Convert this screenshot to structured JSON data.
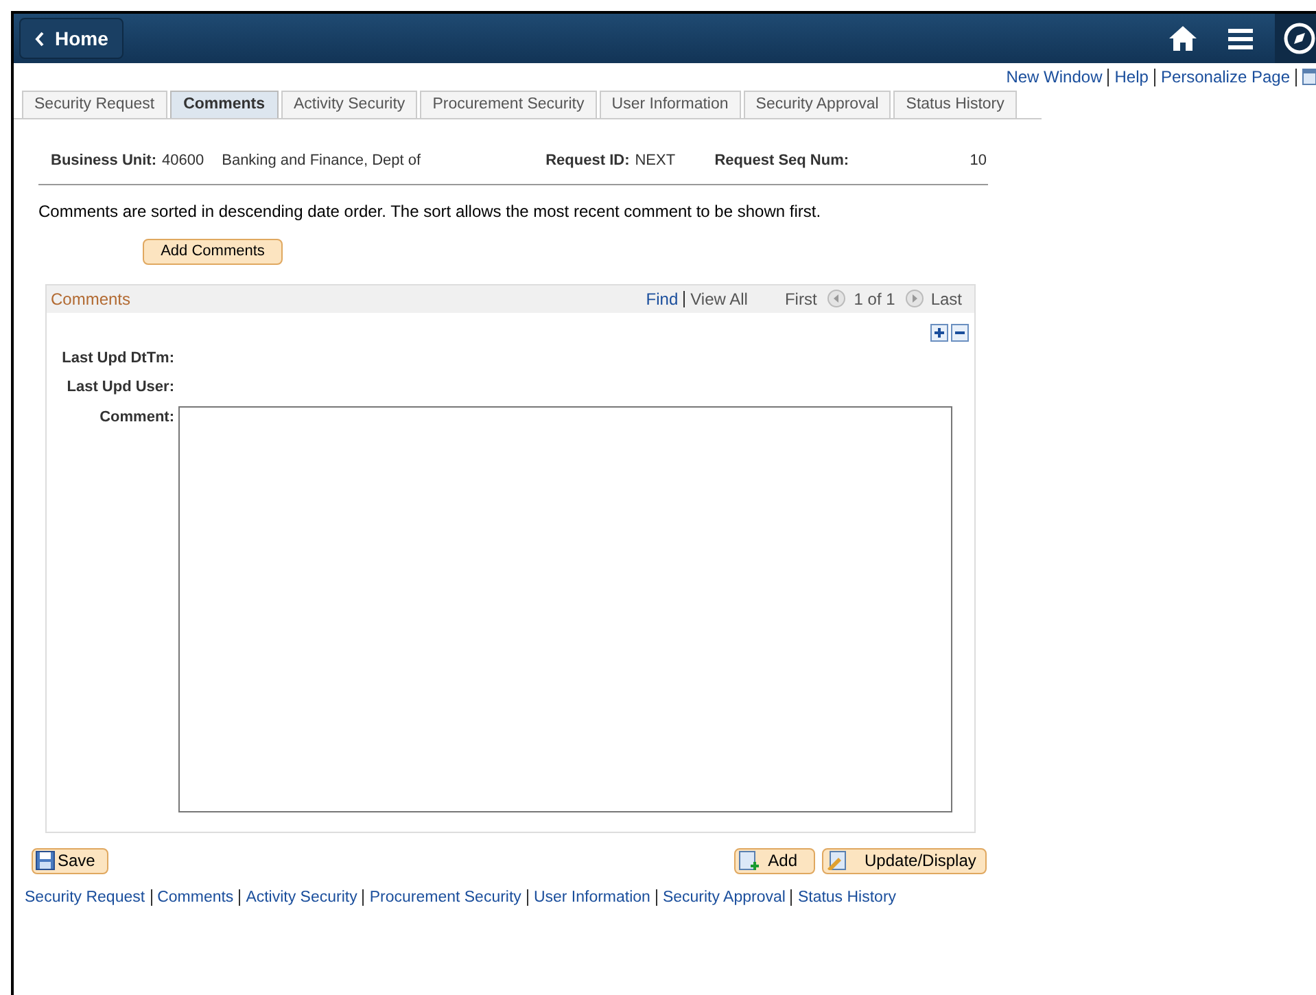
{
  "header": {
    "back_label": "Home"
  },
  "top_links": [
    "New Window",
    "Help",
    "Personalize Page"
  ],
  "tabs": [
    {
      "label": "Security Request",
      "selected": false
    },
    {
      "label": "Comments",
      "selected": true
    },
    {
      "label": "Activity Security",
      "selected": false
    },
    {
      "label": "Procurement Security",
      "selected": false
    },
    {
      "label": "User Information",
      "selected": false
    },
    {
      "label": "Security Approval",
      "selected": false
    },
    {
      "label": "Status History",
      "selected": false
    }
  ],
  "info": {
    "business_unit_label": "Business Unit:",
    "business_unit": "40600",
    "business_unit_name": "Banking and Finance, Dept of",
    "request_id_label": "Request ID:",
    "request_id": "NEXT",
    "seq_label": "Request Seq Num:",
    "seq": "10"
  },
  "note": "Comments are sorted in descending date order. The sort allows the most recent comment to be shown first.",
  "add_comments_button": "Add Comments",
  "comments_panel": {
    "title": "Comments",
    "find": "Find",
    "view_all": "View All",
    "first": "First",
    "count": "1 of 1",
    "last": "Last",
    "fields": [
      "Last Upd DtTm:",
      "Last Upd User:",
      "Comment:"
    ]
  },
  "buttons": {
    "save": "Save",
    "add": "Add",
    "update": "Update/Display"
  },
  "footer_links": [
    "Security Request",
    "Comments",
    "Activity Security",
    "Procurement Security",
    "User Information",
    "Security Approval",
    "Status History"
  ]
}
